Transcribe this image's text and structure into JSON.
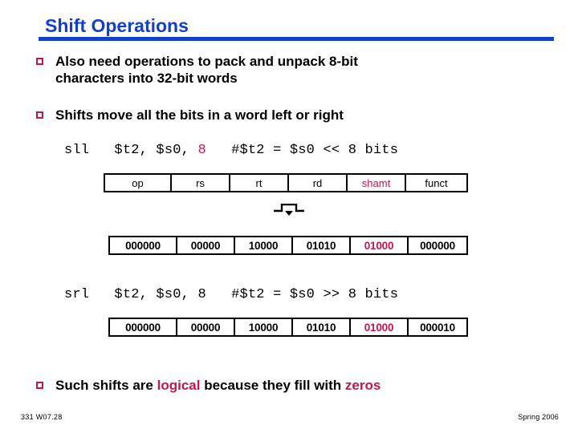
{
  "slide": {
    "title": "Shift Operations",
    "accent_blue": "#1340c8",
    "accent_red": "#c3164b"
  },
  "bullets": {
    "b1": "Also need operations to pack and unpack 8-bit\ncharacters into 32-bit words",
    "b2": "Shifts move all the bits in a word left or right",
    "b3_part1": "Such shifts are ",
    "b3_logical": "logical",
    "b3_part2": " because they fill with ",
    "b3_zeros": "zeros"
  },
  "instructions": {
    "sll": {
      "mnemonic": "sll",
      "operands_pre": "   $t2, $s0, ",
      "shamt": "8",
      "comment": "   #$t2 = $s0 << 8 bits"
    },
    "srl": {
      "mnemonic": "srl",
      "operands_pre": "   $t2, $s0, ",
      "shamt": "8",
      "comment": "   #$t2 = $s0 >> 8 bits"
    }
  },
  "field_table": {
    "headers": [
      "op",
      "rs",
      "rt",
      "rd",
      "shamt",
      "funct"
    ],
    "sll_bits": [
      "000000",
      "00000",
      "10000",
      "01010",
      "01000",
      "000000"
    ],
    "srl_bits": [
      "000000",
      "00000",
      "10000",
      "01010",
      "01000",
      "000010"
    ]
  },
  "pointer_icon": "down-pointer-icon",
  "footer": {
    "left": "331  W07.28",
    "right": "Spring 2006"
  }
}
